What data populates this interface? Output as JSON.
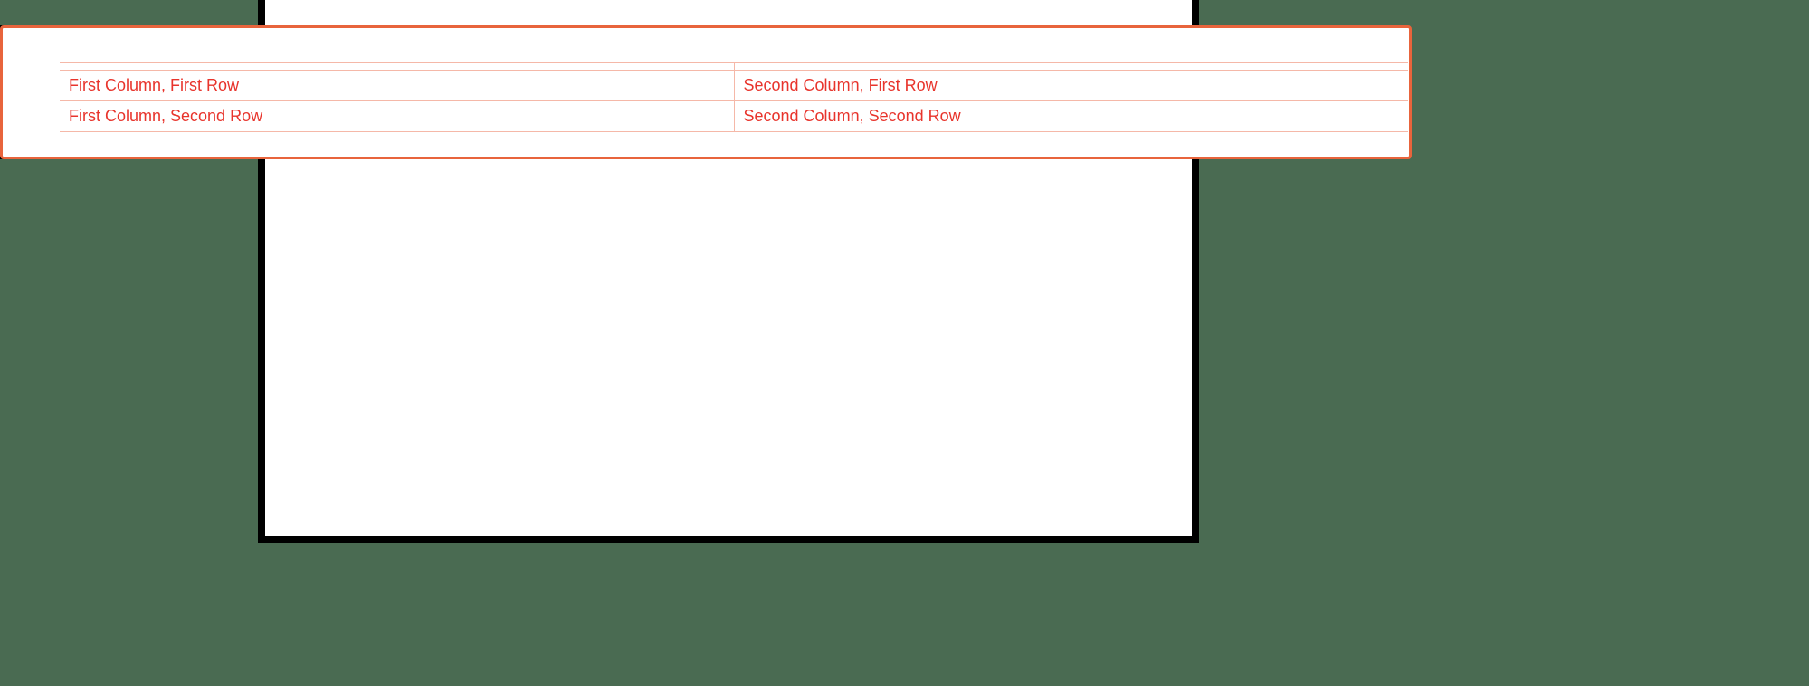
{
  "table": {
    "rows": [
      {
        "col1": "First Column, First Row",
        "col2": "Second Column, First Row"
      },
      {
        "col1": "First Column, Second Row",
        "col2": "Second Column, Second Row"
      }
    ]
  },
  "colors": {
    "background": "#4a6b52",
    "canvas": "#ffffff",
    "canvas_border": "#000000",
    "overlay_border": "#e8643c",
    "table_text": "#e8342c",
    "table_border": "#f5b8a8"
  }
}
